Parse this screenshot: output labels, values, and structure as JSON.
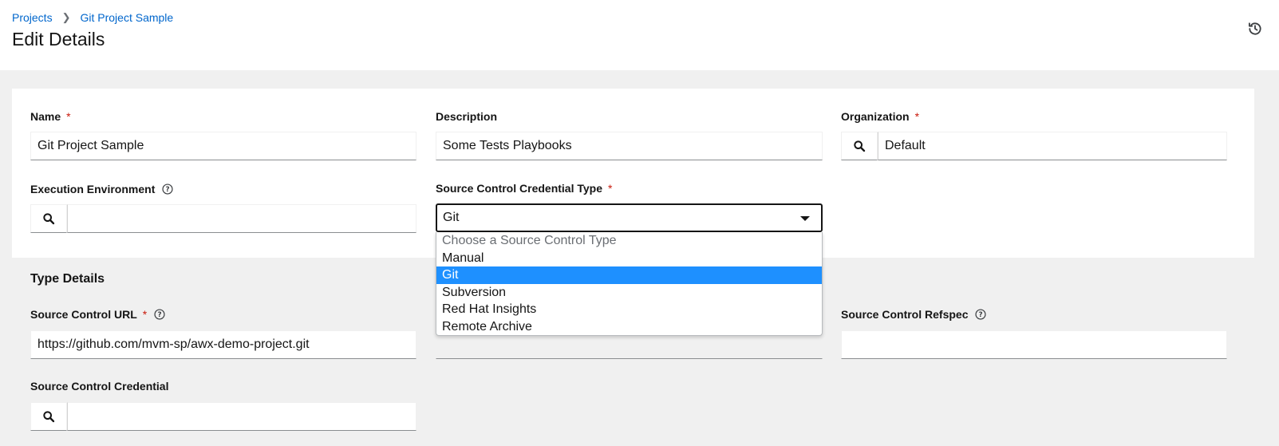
{
  "header": {
    "breadcrumb": [
      "Projects",
      "Git Project Sample"
    ],
    "title": "Edit Details",
    "history_icon": "history-icon"
  },
  "form": {
    "name": {
      "label": "Name",
      "required": "*",
      "value": "Git Project Sample"
    },
    "description": {
      "label": "Description",
      "value": "Some Tests Playbooks"
    },
    "organization": {
      "label": "Organization",
      "required": "*",
      "value": "Default"
    },
    "execution_environment": {
      "label": "Execution Environment",
      "value": ""
    },
    "scm_type": {
      "label": "Source Control Credential Type",
      "required": "*",
      "value": "Git",
      "options": [
        "Choose a Source Control Type",
        "Manual",
        "Git",
        "Subversion",
        "Red Hat Insights",
        "Remote Archive"
      ]
    }
  },
  "type_details": {
    "heading": "Type Details",
    "scm_url": {
      "label": "Source Control URL",
      "required": "*",
      "value": "https://github.com/mvm-sp/awx-demo-project.git"
    },
    "scm_refspec": {
      "label": "Source Control Refspec",
      "value": ""
    },
    "scm_credential": {
      "label": "Source Control Credential",
      "value": ""
    }
  },
  "colors": {
    "link": "#0066cc",
    "required": "#c9190b",
    "selected_option": "#1e90ff"
  }
}
